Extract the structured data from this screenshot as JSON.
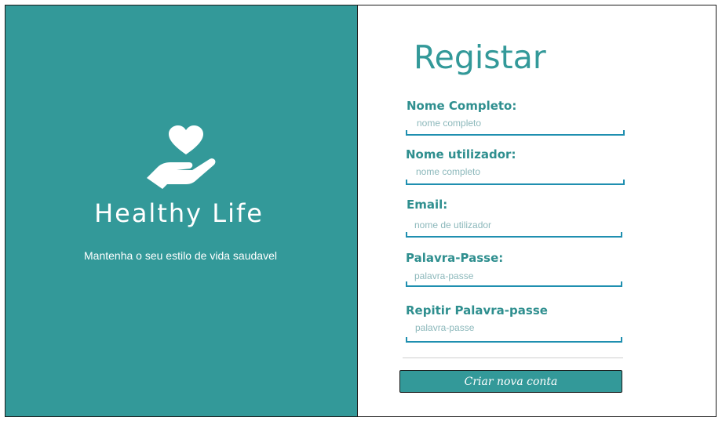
{
  "brand": {
    "name": "Healthy Life",
    "tagline": "Mantenha o seu estilo de vida saudavel"
  },
  "form": {
    "title": "Registar",
    "fields": [
      {
        "label": "Nome Completo:",
        "placeholder": "nome completo"
      },
      {
        "label": "Nome utilizador:",
        "placeholder": "nome completo"
      },
      {
        "label": "Email:",
        "placeholder": "nome de utilizador"
      },
      {
        "label": "Palavra-Passe:",
        "placeholder": "palavra-passe"
      },
      {
        "label": "Repitir Palavra-passe",
        "placeholder": "palavra-passe"
      }
    ],
    "submit_label": "Criar nova conta"
  },
  "colors": {
    "teal": "#339999",
    "underline": "#1f8fb0",
    "white": "#ffffff"
  },
  "icons": {
    "logo": "heart-in-hand-icon"
  }
}
